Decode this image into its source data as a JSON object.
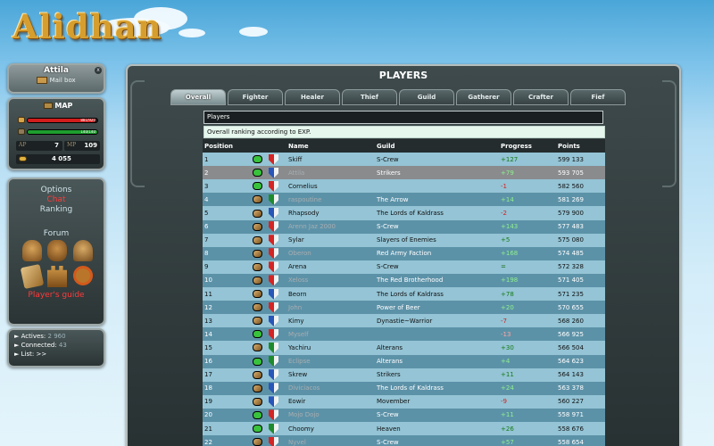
{
  "site": {
    "logo": "Alidhan"
  },
  "account": {
    "name": "Attila",
    "mailbox": "Mail box"
  },
  "stats": {
    "map_label": "MAP",
    "hp_text": "881/920",
    "hp_ratio": 0.957,
    "sp_text": "140/140",
    "sp_ratio": 1.0,
    "ap_label": "AP",
    "ap_value": "7",
    "mp_label": "MP",
    "mp_value": "109",
    "gold": "4 055"
  },
  "nav": {
    "options": "Options",
    "chat": "Chat",
    "ranking": "Ranking",
    "forum": "Forum",
    "guide": "Player's guide"
  },
  "online": {
    "actives_label": "Actives:",
    "actives_value": "2 960",
    "connected_label": "Connected:",
    "connected_value": "43",
    "list_label": "List:",
    "list_value": ">>"
  },
  "main": {
    "title": "PLAYERS",
    "tabs": [
      "Overall",
      "Fighter",
      "Healer",
      "Thief",
      "Guild",
      "Gatherer",
      "Crafter",
      "Fief"
    ],
    "dropdown_value": "Players",
    "info": "Overall ranking according to EXP.",
    "columns": [
      "Position",
      "",
      "",
      "Name",
      "Guild",
      "Progress",
      "Points"
    ],
    "rows": [
      {
        "pos": "1",
        "name": "Skiff",
        "guild": "S-Crew",
        "progress": "+127",
        "points": "599 133",
        "icon": "green",
        "shield": "red",
        "gray": false
      },
      {
        "pos": "2",
        "name": "Attila",
        "guild": "Strikers",
        "progress": "+79",
        "points": "593 705",
        "icon": "green",
        "shield": "blue",
        "gray": true
      },
      {
        "pos": "3",
        "name": "Cornelius",
        "guild": "",
        "progress": "-1",
        "points": "582 560",
        "icon": "green",
        "shield": "red",
        "gray": false
      },
      {
        "pos": "4",
        "name": "raspoutine",
        "guild": "The Arrow",
        "progress": "+14",
        "points": "581 269",
        "icon": "brown",
        "shield": "green",
        "gray": true
      },
      {
        "pos": "5",
        "name": "Rhapsody",
        "guild": "The Lords of Kaldrass",
        "progress": "-2",
        "points": "579 900",
        "icon": "brown",
        "shield": "blue",
        "gray": false
      },
      {
        "pos": "6",
        "name": "Arenn Jaz 2000",
        "guild": "S-Crew",
        "progress": "+143",
        "points": "577 483",
        "icon": "brown",
        "shield": "red",
        "gray": true
      },
      {
        "pos": "7",
        "name": "Sylar",
        "guild": "Slayers of Enemies",
        "progress": "+5",
        "points": "575 080",
        "icon": "brown",
        "shield": "red",
        "gray": false
      },
      {
        "pos": "8",
        "name": "Oberon",
        "guild": "Red Army Faction",
        "progress": "+168",
        "points": "574 485",
        "icon": "brown",
        "shield": "red",
        "gray": true
      },
      {
        "pos": "9",
        "name": "Arena",
        "guild": "S-Crew",
        "progress": "=",
        "points": "572 328",
        "icon": "brown",
        "shield": "red",
        "gray": false
      },
      {
        "pos": "10",
        "name": "Xeloss",
        "guild": "The Red Brotherhood",
        "progress": "+198",
        "points": "571 405",
        "icon": "brown",
        "shield": "red",
        "gray": true
      },
      {
        "pos": "11",
        "name": "Beorn",
        "guild": "The Lords of Kaldrass",
        "progress": "+78",
        "points": "571 235",
        "icon": "brown",
        "shield": "blue",
        "gray": false
      },
      {
        "pos": "12",
        "name": "John",
        "guild": "Power of Beer",
        "progress": "+20",
        "points": "570 655",
        "icon": "brown",
        "shield": "red",
        "gray": true
      },
      {
        "pos": "13",
        "name": "Kimy",
        "guild": "Dynastie~Warrior",
        "progress": "-7",
        "points": "568 260",
        "icon": "brown",
        "shield": "blue",
        "gray": false
      },
      {
        "pos": "14",
        "name": "Myself",
        "guild": "",
        "progress": "-13",
        "points": "566 925",
        "icon": "green",
        "shield": "red",
        "gray": true
      },
      {
        "pos": "15",
        "name": "Yachiru",
        "guild": "Alterans",
        "progress": "+30",
        "points": "566 504",
        "icon": "brown",
        "shield": "green",
        "gray": false
      },
      {
        "pos": "16",
        "name": "Eclipse",
        "guild": "Alterans",
        "progress": "+4",
        "points": "564 623",
        "icon": "green",
        "shield": "green",
        "gray": true
      },
      {
        "pos": "17",
        "name": "Skrew",
        "guild": "Strikers",
        "progress": "+11",
        "points": "564 143",
        "icon": "brown",
        "shield": "blue",
        "gray": false
      },
      {
        "pos": "18",
        "name": "Diviciacos",
        "guild": "The Lords of Kaldrass",
        "progress": "+24",
        "points": "563 378",
        "icon": "brown",
        "shield": "blue",
        "gray": true
      },
      {
        "pos": "19",
        "name": "Eowir",
        "guild": "Movember",
        "progress": "-9",
        "points": "560 227",
        "icon": "brown",
        "shield": "blue",
        "gray": false
      },
      {
        "pos": "20",
        "name": "Mojo Dojo",
        "guild": "S-Crew",
        "progress": "+11",
        "points": "558 971",
        "icon": "green",
        "shield": "red",
        "gray": true
      },
      {
        "pos": "21",
        "name": "Choomy",
        "guild": "Heaven",
        "progress": "+26",
        "points": "558 676",
        "icon": "green",
        "shield": "green",
        "gray": false
      },
      {
        "pos": "22",
        "name": "Nyvel",
        "guild": "S-Crew",
        "progress": "+57",
        "points": "558 654",
        "icon": "brown",
        "shield": "red",
        "gray": true
      }
    ]
  },
  "colors": {
    "hp": "#d21d1d",
    "sp": "#1e9e2e",
    "row_light": "#94c4d5",
    "row_dark": "#5c92a8",
    "chat": "#ff3a3a"
  }
}
